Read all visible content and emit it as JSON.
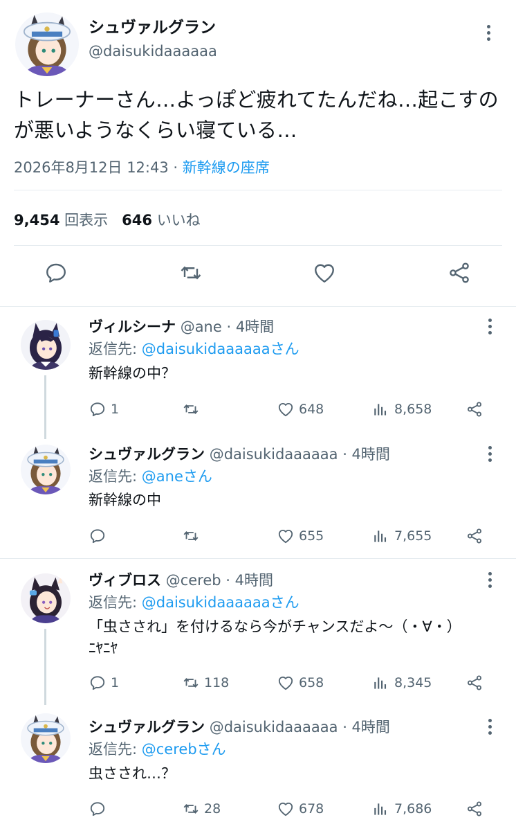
{
  "main_tweet": {
    "author_name": "シュヴァルグラン",
    "author_handle": "@daisukidaaaaaa",
    "text": "トレーナーさん…よっぽど疲れてたんだね…起こすのが悪いようなくらい寝ている…",
    "timestamp": "2026年8月12日 12:43",
    "separator": " · ",
    "location": "新幹線の座席",
    "views_count": "9,454",
    "views_label": "回表示",
    "likes_count": "646",
    "likes_label": "いいね",
    "action_icons": [
      "reply-icon",
      "retweet-icon",
      "like-icon",
      "share-icon"
    ]
  },
  "reply_prefix": "返信先: ",
  "replies": [
    {
      "name": "ヴィルシーナ",
      "handle": "@ane",
      "time": " · 4時間",
      "reply_to": "@daisukidaaaaaaさん",
      "text": "新幹線の中？",
      "replies": "1",
      "retweets": "",
      "likes": "648",
      "views": "8,658",
      "avatar_hair": "#2a2346",
      "avatar_accent": "#3b7bd4"
    },
    {
      "name": "シュヴァルグラン",
      "handle": "@daisukidaaaaaa",
      "time": " · 4時間",
      "reply_to": "@aneさん",
      "text": "新幹線の中",
      "replies": "",
      "retweets": "",
      "likes": "655",
      "views": "7,655",
      "avatar_hair": "#7a5a3a",
      "avatar_accent": "#e8eef6"
    },
    {
      "name": "ヴィブロス",
      "handle": "@cereb",
      "time": " · 4時間",
      "reply_to": "@daisukidaaaaaaさん",
      "text": "「虫さされ」を付けるなら今がチャンスだよ〜（・∀・）ﾆﾔﾆﾔ",
      "replies": "1",
      "retweets": "118",
      "likes": "658",
      "views": "8,345",
      "avatar_hair": "#2b2233",
      "avatar_accent": "#5aa9e6"
    },
    {
      "name": "シュヴァルグラン",
      "handle": "@daisukidaaaaaa",
      "time": " · 4時間",
      "reply_to": "@cerebさん",
      "text": "虫さされ…？",
      "replies": "",
      "retweets": "28",
      "likes": "678",
      "views": "7,686",
      "avatar_hair": "#7a5a3a",
      "avatar_accent": "#e8eef6"
    }
  ],
  "colors": {
    "link": "#1d9bf0",
    "secondary_text": "#536471",
    "divider": "#e6ecf0"
  }
}
